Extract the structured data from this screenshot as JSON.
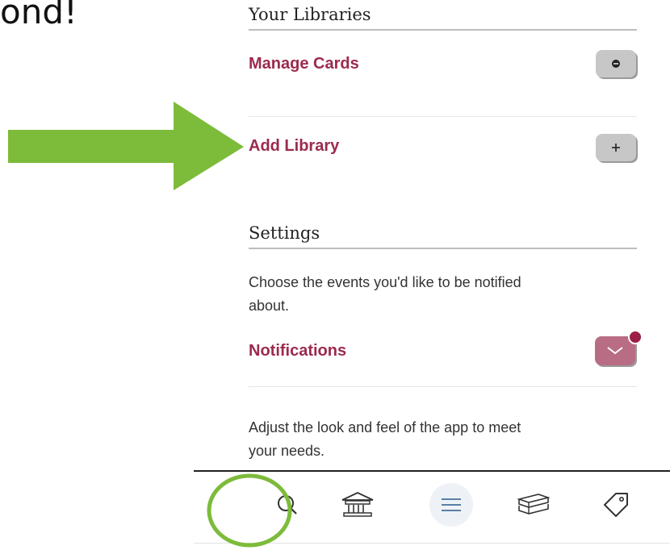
{
  "stray_text": "ond!",
  "libraries": {
    "heading": "Your Libraries",
    "manage_cards_label": "Manage Cards",
    "add_library_label": "Add Library"
  },
  "settings": {
    "heading": "Settings",
    "notifications_description": "Choose the events you'd like to be notified about.",
    "notifications_label": "Notifications",
    "appearance_description": "Adjust the look and feel of the app to meet your needs."
  },
  "nav": {
    "items": [
      {
        "icon": "search-icon"
      },
      {
        "icon": "library-building-icon"
      },
      {
        "icon": "menu-icon",
        "active": true
      },
      {
        "icon": "books-stack-icon"
      },
      {
        "icon": "tag-icon"
      }
    ]
  },
  "colors": {
    "accent": "#9c2a4d",
    "arrow": "#7dbb3a",
    "button_gray": "#c7c7c7",
    "button_pink": "#b86d84",
    "ring": "#7dbb3a"
  }
}
